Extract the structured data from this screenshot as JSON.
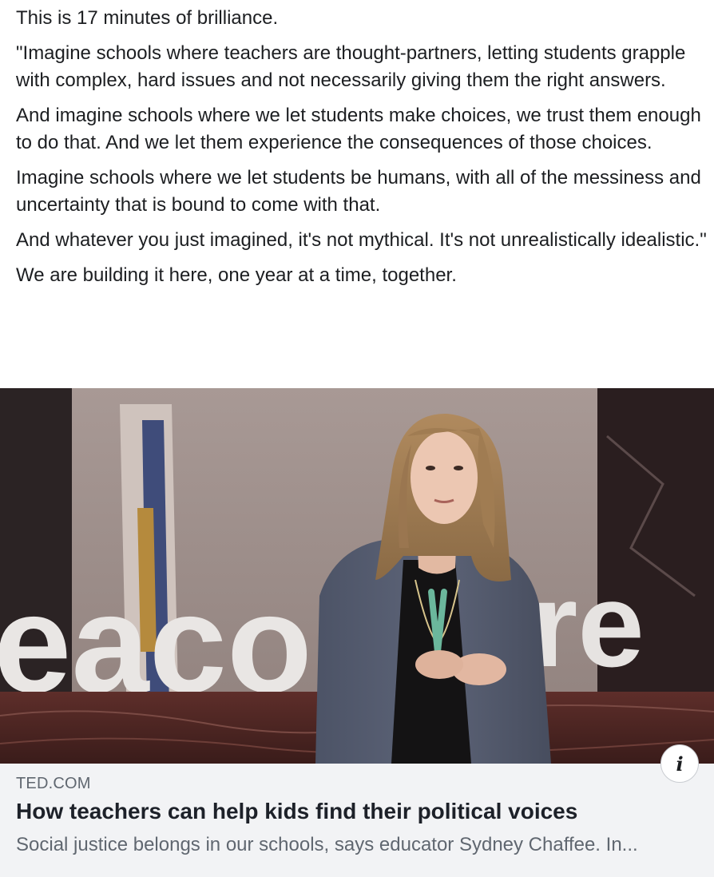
{
  "post": {
    "paragraphs": [
      "This is 17 minutes of brilliance.",
      "\"Imagine schools where teachers are thought-partners, letting students grapple with complex, hard issues and not necessarily giving them the right answers.",
      "And imagine schools where we let students make choices, we trust them enough to do that. And we let them experience the consequences of those choices.",
      "Imagine schools where we let students be humans, with all of the messiness and uncertainty that is bound to come with that.",
      "And whatever you just imagined, it's not mythical. It's not unrealistically idealistic.\"",
      "We are building it here, one year at a time, together."
    ]
  },
  "link_card": {
    "image": {
      "backdrop_letters_left": "eaco",
      "backdrop_letters_right": "tre"
    },
    "info_icon": "i",
    "domain": "TED.COM",
    "title": "How teachers can help kids find their political voices",
    "description": "Social justice belongs in our schools, says educator Sydney Chaffee. In..."
  }
}
